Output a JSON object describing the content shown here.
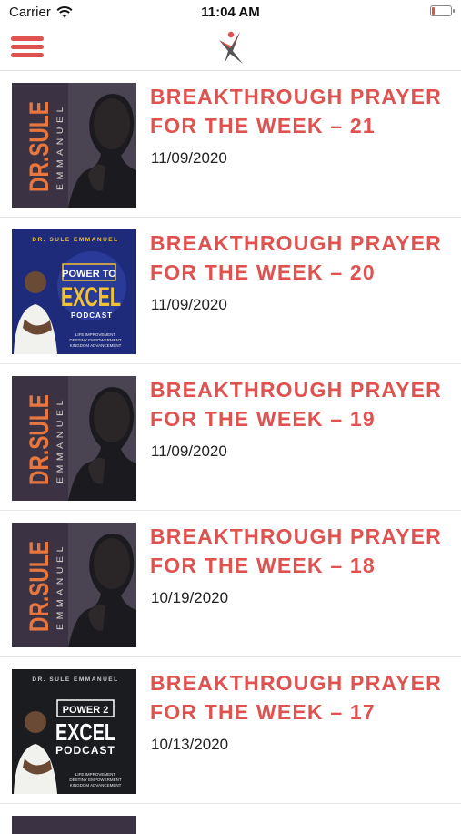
{
  "status_bar": {
    "carrier": "Carrier",
    "time": "11:04 AM",
    "battery_level": 0.15,
    "wifi_icon": "wifi-icon",
    "battery_icon": "battery-icon"
  },
  "nav": {
    "menu_icon": "hamburger-menu-icon",
    "logo_icon": "app-logo-icon"
  },
  "colors": {
    "accent": "#e0524f",
    "text": "#222222",
    "divider": "#e6e6e6"
  },
  "items": [
    {
      "title": "Breakthrough Prayer for the Week – 21",
      "date": "11/09/2020",
      "cover": "dr-sule",
      "cover_text": {
        "line1": "DR.SULE",
        "line2": "EMMANUEL"
      }
    },
    {
      "title": "Breakthrough Prayer for the Week – 20",
      "date": "11/09/2020",
      "cover": "power-to-excel",
      "cover_text": {
        "top": "DR. SULE EMMANUEL",
        "power": "POWER TO",
        "excel": "EXCEL",
        "sub": "PODCAST",
        "tag1": "LIFE IMPROVEMENT",
        "tag2": "DESTINY EMPOWERMENT",
        "tag3": "KINGDOM ADVANCEMENT"
      }
    },
    {
      "title": "Breakthrough Prayer for the Week – 19",
      "date": "11/09/2020",
      "cover": "dr-sule",
      "cover_text": {
        "line1": "DR.SULE",
        "line2": "EMMANUEL"
      }
    },
    {
      "title": "Breakthrough Prayer for the Week – 18",
      "date": "10/19/2020",
      "cover": "dr-sule",
      "cover_text": {
        "line1": "DR.SULE",
        "line2": "EMMANUEL"
      }
    },
    {
      "title": "Breakthrough Prayer for the Week – 17",
      "date": "10/13/2020",
      "cover": "power-2-excel",
      "cover_text": {
        "top": "DR. SULE EMMANUEL",
        "power": "POWER 2",
        "excel": "EXCEL",
        "sub": "PODCAST",
        "tag1": "LIFE IMPROVEMENT",
        "tag2": "DESTINY EMPOWERMENT",
        "tag3": "KINGDOM ADVANCEMENT"
      }
    }
  ]
}
